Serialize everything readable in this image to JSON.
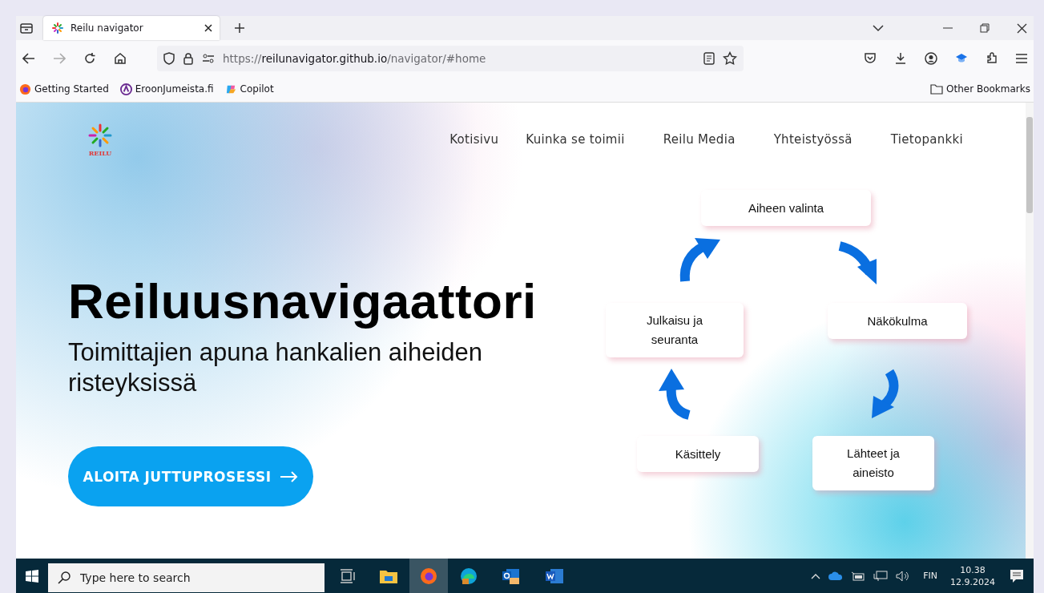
{
  "browser": {
    "tab_title": "Reilu navigator",
    "url": {
      "scheme": "https://",
      "host": "reilunavigator.github.io",
      "path": "/navigator/#home"
    },
    "bookmarks": [
      {
        "label": "Getting Started",
        "kind": "firefox"
      },
      {
        "label": "EroonJumeista.fi",
        "kind": "purple"
      },
      {
        "label": "Copilot",
        "kind": "copilot"
      }
    ],
    "other_bookmarks": "Other Bookmarks"
  },
  "site": {
    "logo_text": "REILU",
    "nav": [
      "Kotisivu",
      "Kuinka se toimii",
      "Reilu Media",
      "Yhteistyössä",
      "Tietopankki"
    ],
    "title": "Reiluusnavigaattori",
    "subtitle": "Toimittajien apuna hankalien aiheiden risteyksissä",
    "cta": "ALOITA JUTTUPROSESSI",
    "cycle": [
      {
        "label": "Aiheen valinta"
      },
      {
        "label": "Julkaisu ja seuranta"
      },
      {
        "label": "Näkökulma"
      },
      {
        "label": "Käsittely"
      },
      {
        "label": "Lähteet ja aineisto"
      }
    ]
  },
  "taskbar": {
    "search_placeholder": "Type here to search",
    "language": "FIN",
    "time": "10.38",
    "date": "12.9.2024"
  }
}
